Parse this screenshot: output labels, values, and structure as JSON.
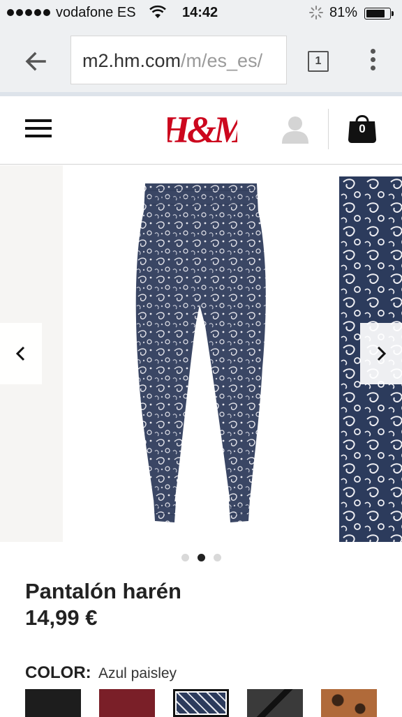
{
  "status_bar": {
    "carrier": "vodafone ES",
    "time": "14:42",
    "battery": "81%",
    "battery_level": 0.81
  },
  "browser": {
    "url_host": "m2.hm.com",
    "url_path": "/m/es_es/",
    "tab_count": "1"
  },
  "header": {
    "logo": "H&M",
    "bag_count": "0"
  },
  "carousel": {
    "slide_count": 3,
    "active_index": 1
  },
  "product": {
    "name": "Pantalón harén",
    "price": "14,99 €",
    "color_label": "COLOR:",
    "color_value": "Azul paisley",
    "swatches": [
      {
        "name": "black",
        "color": "#1d1d1d"
      },
      {
        "name": "burgundy",
        "color": "#7a1f28"
      },
      {
        "name": "azul-paisley",
        "color": "#2c3b5c",
        "selected": true
      },
      {
        "name": "dark-grey",
        "color": "#2a2a2a"
      },
      {
        "name": "animal-print",
        "color": "#b06a3a"
      }
    ]
  },
  "colors": {
    "brand_red": "#cc071e",
    "pants_navy": "#2c3b5c"
  }
}
